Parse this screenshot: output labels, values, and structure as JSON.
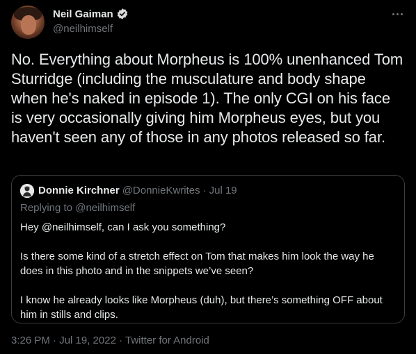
{
  "author": {
    "display_name": "Neil Gaiman",
    "handle": "@neilhimself",
    "verified_icon": "verified-badge-icon"
  },
  "tweet": {
    "text": "No. Everything about Morpheus is 100% unenhanced Tom Sturridge (including the musculature and body shape when he's naked in episode 1). The only CGI on his face is very occasionally giving him Morpheus eyes, but you haven't seen any of those in any photos released so far."
  },
  "quoted_tweet": {
    "display_name": "Donnie Kirchner",
    "handle": "@DonnieKwrites",
    "separator": "·",
    "date": "Jul 19",
    "replying_to": "Replying to @neilhimself",
    "paragraphs": [
      "Hey @neilhimself, can I ask you something?",
      "Is there some kind of a stretch effect on Tom that makes him look the way he does in this photo and in the snippets we’ve seen?",
      "I know he already looks like Morpheus (duh), but there’s something OFF about him in stills and clips."
    ]
  },
  "meta": {
    "footer": "3:26 PM · Jul 19, 2022 · Twitter for Android"
  },
  "colors": {
    "background": "#000000",
    "text_primary": "#e7e9ea",
    "text_secondary": "#71767b",
    "verified_badge": "#d9d9d9",
    "quote_border": "#3a3d41"
  }
}
